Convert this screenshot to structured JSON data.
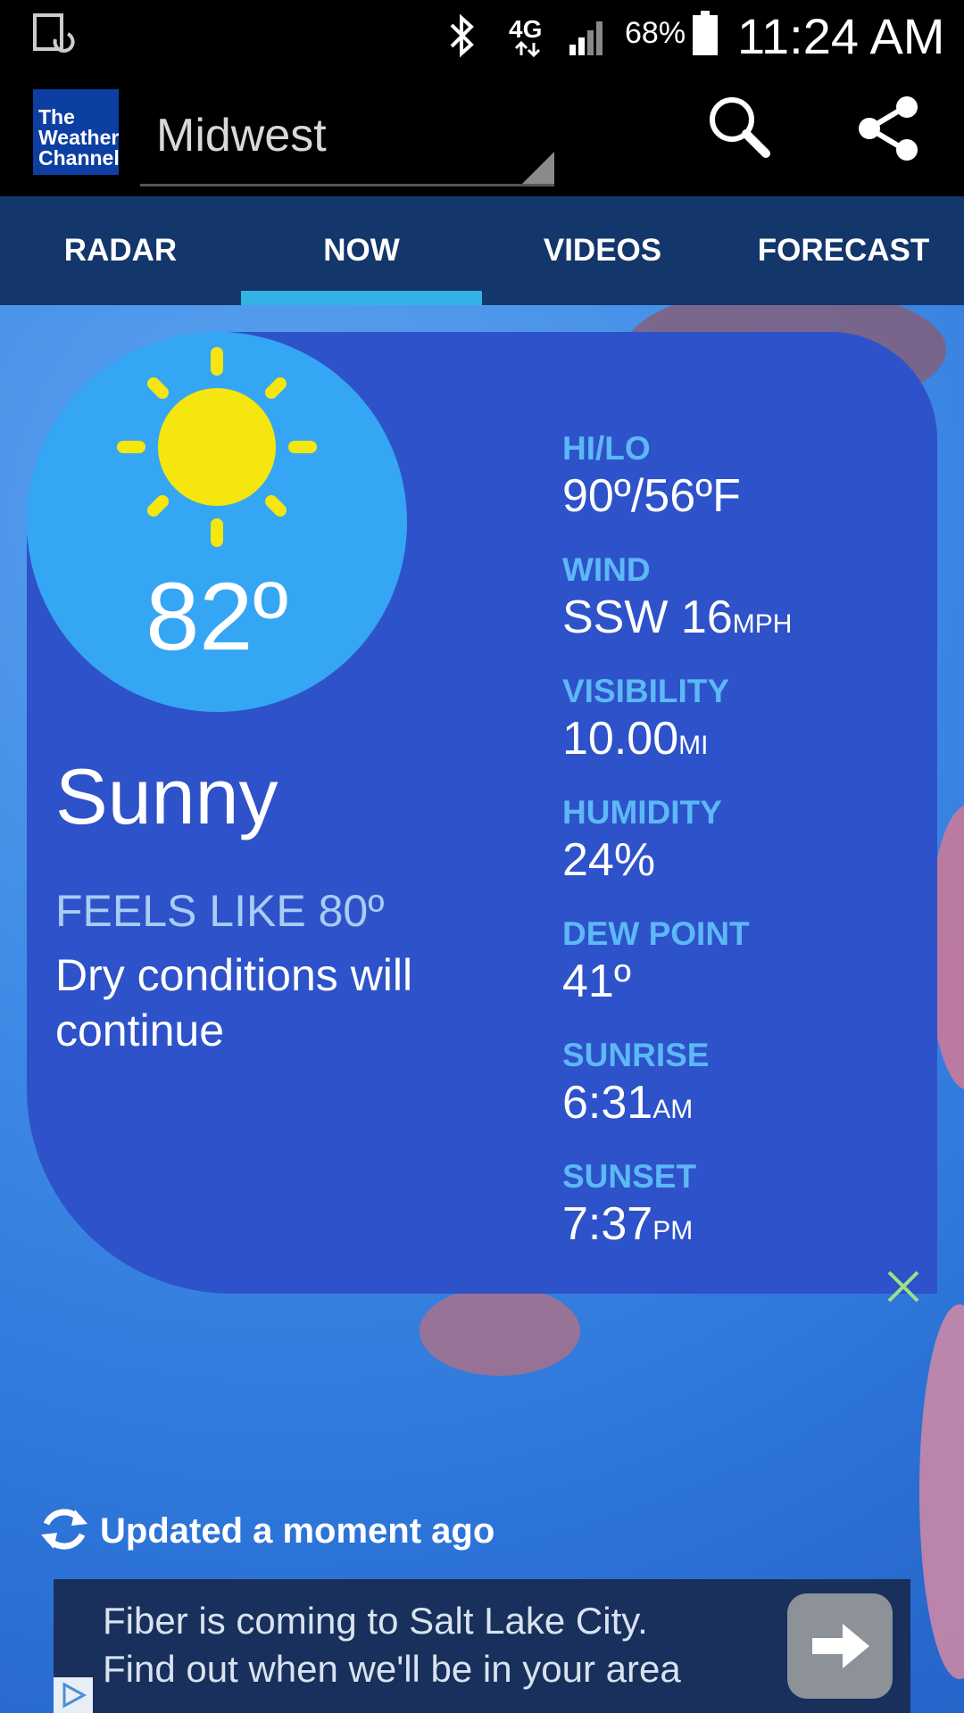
{
  "status_bar": {
    "battery_percent": "68%",
    "time": "11:24 AM",
    "network": "4G LTE",
    "icons": [
      "screen-rotate-icon",
      "bluetooth-icon",
      "signal-icon",
      "battery-icon"
    ]
  },
  "app_bar": {
    "logo_lines": [
      "The",
      "Weather",
      "Channel"
    ],
    "location": "Midwest",
    "icons": [
      "search-icon",
      "share-icon"
    ]
  },
  "tabs": [
    {
      "label": "RADAR",
      "active": false
    },
    {
      "label": "NOW",
      "active": true
    },
    {
      "label": "VIDEOS",
      "active": false
    },
    {
      "label": "FORECAST",
      "active": false
    }
  ],
  "current": {
    "temperature": "82º",
    "condition": "Sunny",
    "feels_like": "FEELS LIKE 80º",
    "description": "Dry conditions will continue",
    "icon": "sun-icon"
  },
  "stats": {
    "hilo": {
      "label": "HI/LO",
      "value": "90º/56ºF",
      "unit": ""
    },
    "wind": {
      "label": "WIND",
      "value": "SSW 16",
      "unit": "MPH"
    },
    "visibility": {
      "label": "VISIBILITY",
      "value": "10.00",
      "unit": "MI"
    },
    "humidity": {
      "label": "HUMIDITY",
      "value": "24%",
      "unit": ""
    },
    "dew_point": {
      "label": "DEW POINT",
      "value": "41º",
      "unit": ""
    },
    "sunrise": {
      "label": "SUNRISE",
      "value": "6:31",
      "unit": "AM"
    },
    "sunset": {
      "label": "SUNSET",
      "value": "7:37",
      "unit": "PM"
    }
  },
  "updated_text": "Updated a moment ago",
  "ad": {
    "line1": "Fiber is coming to Salt Lake City.",
    "line2": "Find out when we'll be in your area"
  },
  "colors": {
    "tab_bar": "#13366b",
    "tab_indicator": "#33b3e5",
    "card": "#2e52c9",
    "temp_circle": "#35a6f4",
    "sun": "#f5e60f",
    "stat_label": "#5cb8f6"
  }
}
